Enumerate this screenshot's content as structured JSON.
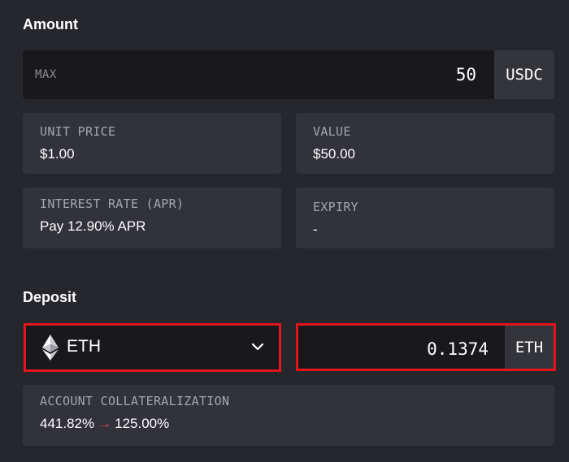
{
  "amount": {
    "title": "Amount",
    "max_label": "MAX",
    "value": "50",
    "unit": "USDC"
  },
  "info": {
    "unit_price": {
      "label": "UNIT PRICE",
      "value": "$1.00"
    },
    "value": {
      "label": "VALUE",
      "value": "$50.00"
    },
    "interest_rate": {
      "label": "INTEREST RATE (APR)",
      "value": "Pay 12.90% APR"
    },
    "expiry": {
      "label": "EXPIRY",
      "value": "-"
    }
  },
  "deposit": {
    "title": "Deposit",
    "token": {
      "name": "ETH",
      "icon": "ethereum-icon"
    },
    "amount": "0.1374",
    "unit": "ETH"
  },
  "collateralization": {
    "label": "ACCOUNT COLLATERALIZATION",
    "from": "441.82%",
    "arrow": "→",
    "to": "125.00%",
    "arrow_color": "#e5504b"
  },
  "colors": {
    "background": "#26272c",
    "input_bg": "#19191d",
    "card_bg": "#31323a",
    "highlight": "#e3141b"
  }
}
